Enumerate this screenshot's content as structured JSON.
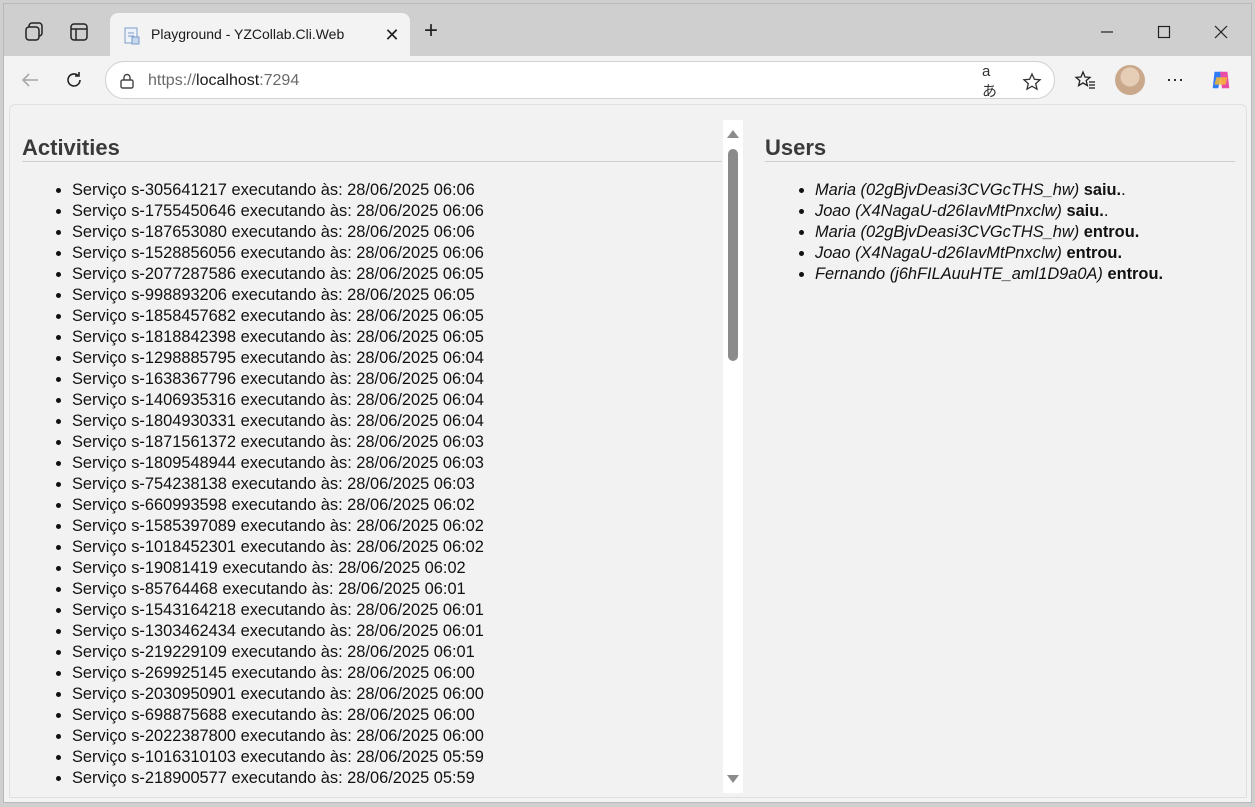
{
  "browser": {
    "tab": {
      "title": "Playground - YZCollab.Cli.Web"
    },
    "address": {
      "protocol": "https://",
      "host": "localhost",
      "port": ":7294"
    },
    "icons": {
      "workspaces": "workspaces-icon",
      "tab_actions": "tab-actions-icon",
      "favicon": "page-favicon-icon",
      "close": "close-icon",
      "new_tab": "plus-icon",
      "minimize": "minimize-icon",
      "maximize": "maximize-icon",
      "window_close": "window-close-icon",
      "back": "back-arrow-icon",
      "refresh": "refresh-icon",
      "lock": "lock-icon",
      "read_aloud": "read-aloud-icon",
      "favorite": "star-icon",
      "favorites": "favorites-icon",
      "more": "more-icon",
      "copilot": "copilot-icon"
    },
    "read_aloud_label": "aあ",
    "more_label": "⋯",
    "close_glyph": "✕",
    "new_tab_glyph": "+"
  },
  "activities": {
    "title": "Activities",
    "items": [
      "Serviço s-305641217 executando às: 28/06/2025 06:06",
      "Serviço s-1755450646 executando às: 28/06/2025 06:06",
      "Serviço s-187653080 executando às: 28/06/2025 06:06",
      "Serviço s-1528856056 executando às: 28/06/2025 06:06",
      "Serviço s-2077287586 executando às: 28/06/2025 06:05",
      "Serviço s-998893206 executando às: 28/06/2025 06:05",
      "Serviço s-1858457682 executando às: 28/06/2025 06:05",
      "Serviço s-1818842398 executando às: 28/06/2025 06:05",
      "Serviço s-1298885795 executando às: 28/06/2025 06:04",
      "Serviço s-1638367796 executando às: 28/06/2025 06:04",
      "Serviço s-1406935316 executando às: 28/06/2025 06:04",
      "Serviço s-1804930331 executando às: 28/06/2025 06:04",
      "Serviço s-1871561372 executando às: 28/06/2025 06:03",
      "Serviço s-1809548944 executando às: 28/06/2025 06:03",
      "Serviço s-754238138 executando às: 28/06/2025 06:03",
      "Serviço s-660993598 executando às: 28/06/2025 06:02",
      "Serviço s-1585397089 executando às: 28/06/2025 06:02",
      "Serviço s-1018452301 executando às: 28/06/2025 06:02",
      "Serviço s-19081419 executando às: 28/06/2025 06:02",
      "Serviço s-85764468 executando às: 28/06/2025 06:01",
      "Serviço s-1543164218 executando às: 28/06/2025 06:01",
      "Serviço s-1303462434 executando às: 28/06/2025 06:01",
      "Serviço s-219229109 executando às: 28/06/2025 06:01",
      "Serviço s-269925145 executando às: 28/06/2025 06:00",
      "Serviço s-2030950901 executando às: 28/06/2025 06:00",
      "Serviço s-698875688 executando às: 28/06/2025 06:00",
      "Serviço s-2022387800 executando às: 28/06/2025 06:00",
      "Serviço s-1016310103 executando às: 28/06/2025 05:59",
      "Serviço s-218900577 executando às: 28/06/2025 05:59"
    ]
  },
  "users": {
    "title": "Users",
    "items": [
      {
        "name": "Maria (02gBjvDeasi3CVGcTHS_hw)",
        "action": "saiu.",
        "suffix": "."
      },
      {
        "name": "Joao (X4NagaU-d26IavMtPnxclw)",
        "action": "saiu.",
        "suffix": "."
      },
      {
        "name": "Maria (02gBjvDeasi3CVGcTHS_hw)",
        "action": "entrou.",
        "suffix": ""
      },
      {
        "name": "Joao (X4NagaU-d26IavMtPnxclw)",
        "action": "entrou.",
        "suffix": ""
      },
      {
        "name": "Fernando (j6hFILAuuHTE_aml1D9a0A)",
        "action": "entrou.",
        "suffix": ""
      }
    ]
  }
}
